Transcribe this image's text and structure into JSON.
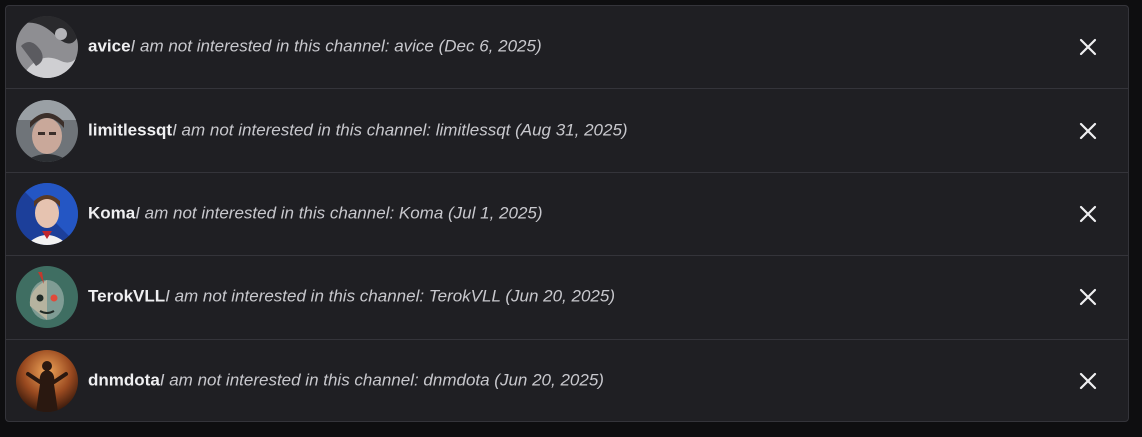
{
  "blocked_list": {
    "items": [
      {
        "name": "avice",
        "reason": "I am not interested in this channel: avice (Dec 6, 2025)",
        "avatar_icon": "avatar-avice-icon",
        "close_icon": "close-icon"
      },
      {
        "name": "limitlessqt",
        "reason": "I am not interested in this channel: limitlessqt (Aug 31, 2025)",
        "avatar_icon": "avatar-limitlessqt-icon",
        "close_icon": "close-icon"
      },
      {
        "name": "Koma",
        "reason": "I am not interested in this channel: Koma (Jul 1, 2025)",
        "avatar_icon": "avatar-koma-icon",
        "close_icon": "close-icon"
      },
      {
        "name": "TerokVLL",
        "reason": "I am not interested in this channel: TerokVLL (Jun 20, 2025)",
        "avatar_icon": "avatar-terokvll-icon",
        "close_icon": "close-icon"
      },
      {
        "name": "dnmdota",
        "reason": "I am not interested in this channel: dnmdota (Jun 20, 2025)",
        "avatar_icon": "avatar-dnmdota-icon",
        "close_icon": "close-icon"
      }
    ]
  },
  "colors": {
    "page_background": "#0e0e10",
    "panel_background": "#1f1f23",
    "divider": "#34343a",
    "name_text": "#efeff1",
    "reason_text": "#c8c8cd",
    "close_icon": "#efeff1"
  }
}
